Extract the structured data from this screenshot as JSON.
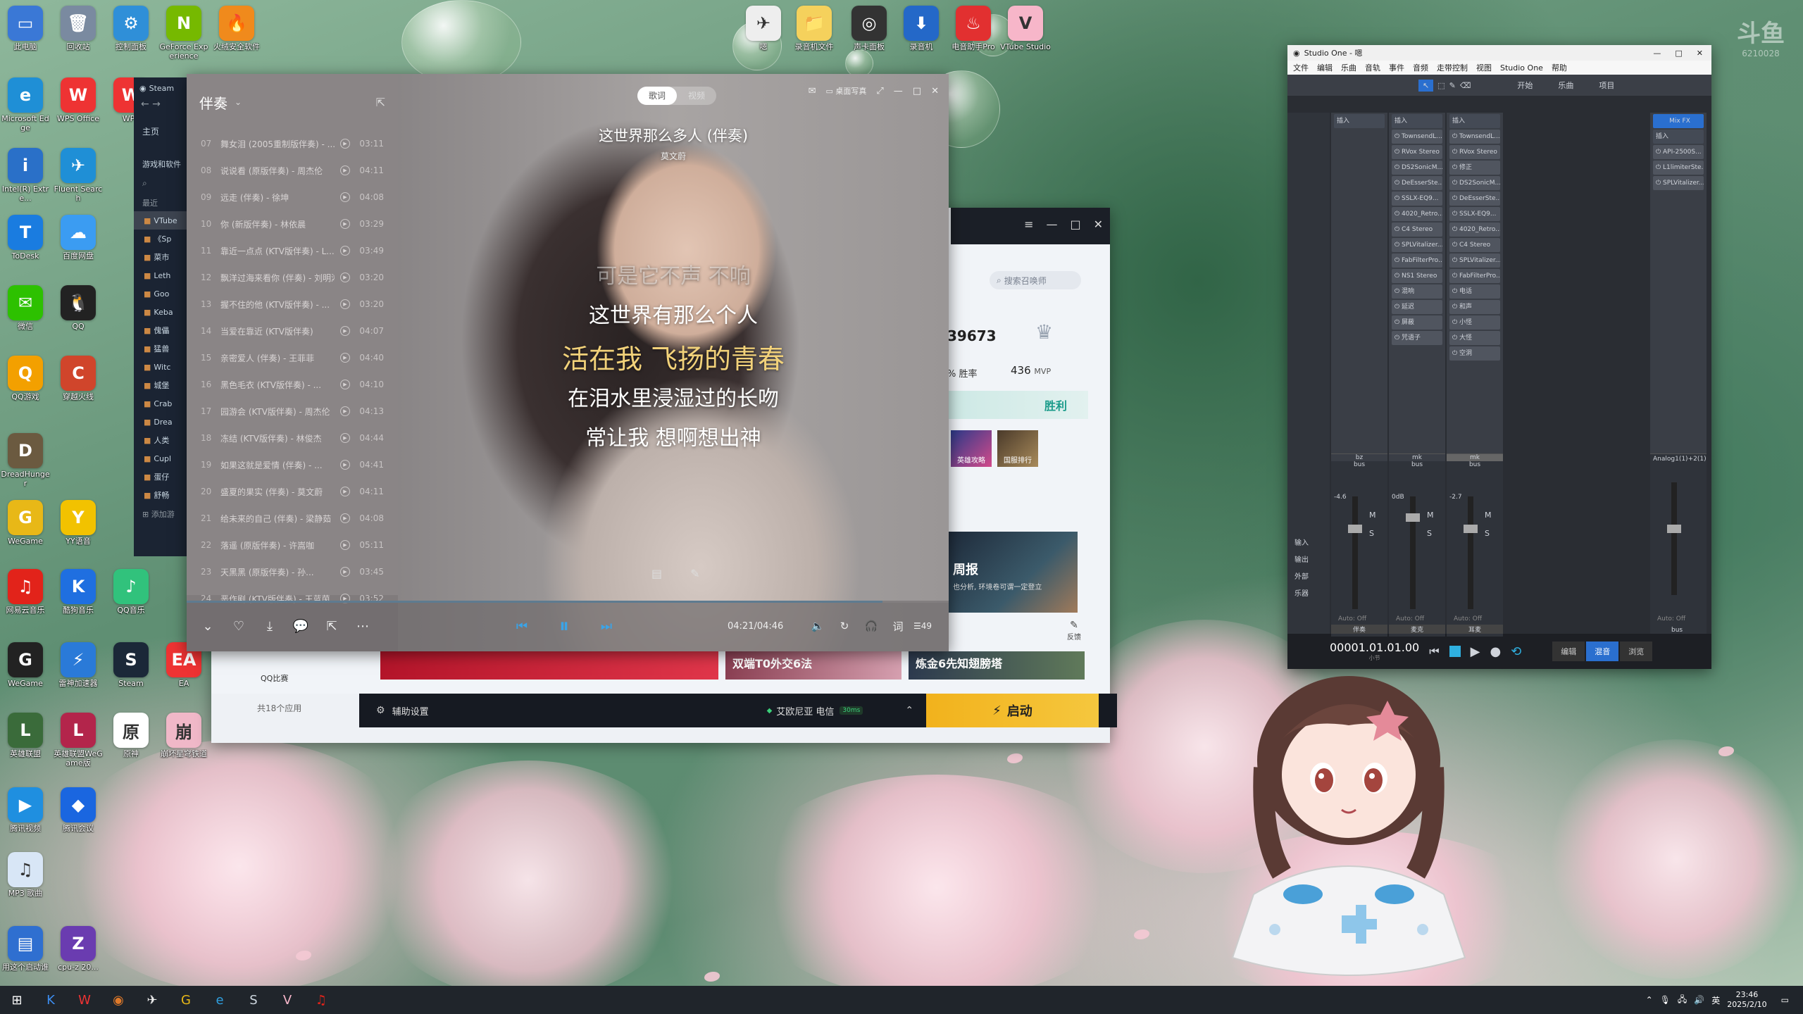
{
  "desktop": {
    "icons_left": [
      {
        "label": "此电脑",
        "color": "#3a78d6",
        "glyph": "▭"
      },
      {
        "label": "回收站",
        "color": "#7a8aa0",
        "glyph": "🗑"
      },
      {
        "label": "控制面板",
        "color": "#2f8fd8",
        "glyph": "⚙"
      },
      {
        "label": "GeForce Experience",
        "color": "#76b900",
        "glyph": "N"
      },
      {
        "label": "火绒安全软件",
        "color": "#f08a1c",
        "glyph": "🔥"
      },
      {
        "label": "Microsoft Edge",
        "color": "#1f8fd6",
        "glyph": "e"
      },
      {
        "label": "WPS Office",
        "color": "#e33",
        "glyph": "W"
      },
      {
        "label": "WPS",
        "color": "#e33",
        "glyph": "W"
      },
      {
        "label": "Intel(R) Extre...",
        "color": "#2a70c8",
        "glyph": "i"
      },
      {
        "label": "Fluent Search",
        "color": "#1f8fd6",
        "glyph": "✈"
      },
      {
        "label": "ToDesk",
        "color": "#1a7ce0",
        "glyph": "T"
      },
      {
        "label": "百度网盘",
        "color": "#3b9cf2",
        "glyph": "☁"
      },
      {
        "label": "微信",
        "color": "#2dc100",
        "glyph": "✉"
      },
      {
        "label": "QQ",
        "color": "#222",
        "glyph": "🐧"
      },
      {
        "label": "QQ游戏",
        "color": "#f3a000",
        "glyph": "Q"
      },
      {
        "label": "穿越火线",
        "color": "#d0452b",
        "glyph": "C"
      },
      {
        "label": "DreadHunger",
        "color": "#6b5a40",
        "glyph": "D"
      },
      {
        "label": "WeGame",
        "color": "#e8b817",
        "glyph": "G"
      },
      {
        "label": "YY语音",
        "color": "#f2c200",
        "glyph": "Y"
      },
      {
        "label": "网易云音乐",
        "color": "#e2231a",
        "glyph": "♫"
      },
      {
        "label": "酷狗音乐",
        "color": "#1f6fe0",
        "glyph": "K"
      },
      {
        "label": "QQ音乐",
        "color": "#31c27c",
        "glyph": "♪"
      },
      {
        "label": "WeGame",
        "color": "#222",
        "glyph": "G"
      },
      {
        "label": "雷神加速器",
        "color": "#2a7ad8",
        "glyph": "⚡"
      },
      {
        "label": "Steam",
        "color": "#1b2838",
        "glyph": "S"
      },
      {
        "label": "EA",
        "color": "#e33",
        "glyph": "EA"
      },
      {
        "label": "英雄联盟",
        "color": "#3a6b3a",
        "glyph": "L"
      },
      {
        "label": "英雄联盟WeGame版",
        "color": "#b3254b",
        "glyph": "L"
      },
      {
        "label": "原神",
        "color": "#fff",
        "glyph": "原"
      },
      {
        "label": "崩坏星穹铁道",
        "color": "#f0b8c8",
        "glyph": "崩"
      },
      {
        "label": "腾讯视频",
        "color": "#1f8fe0",
        "glyph": "▶"
      },
      {
        "label": "腾讯会议",
        "color": "#1a66e0",
        "glyph": "◆"
      },
      {
        "label": "MP3 歌曲",
        "color": "#d8e6f6",
        "glyph": "♫"
      },
      {
        "label": "用这个启动谁",
        "color": "#2f6fd0",
        "glyph": "▤"
      },
      {
        "label": "cpu-z 20...",
        "color": "#6a3cb0",
        "glyph": "Z"
      }
    ],
    "icons_top": [
      {
        "label": "嗯",
        "color": "#eee",
        "glyph": "✈"
      },
      {
        "label": "录音机文件",
        "color": "#f5d15c",
        "glyph": "📁"
      },
      {
        "label": "声卡面板",
        "color": "#333",
        "glyph": "◎"
      },
      {
        "label": "录音机",
        "color": "#2468c8",
        "glyph": "⬇"
      },
      {
        "label": "电音助手Pro",
        "color": "#e23030",
        "glyph": "♨"
      },
      {
        "label": "VTube Studio",
        "color": "#f7b6c9",
        "glyph": "V"
      }
    ],
    "watermark": "斗鱼",
    "watermark_id": "6210028"
  },
  "steam": {
    "title": "Steam",
    "home": "主页",
    "library_label": "游戏和软件",
    "recent": "最近",
    "games": [
      "VTube",
      "《Sp",
      "菜市",
      "Leth",
      "Goo",
      "Keba",
      "傀儡",
      "猛兽",
      "Witc",
      "城堡",
      "Crab",
      "Drea",
      "人类",
      "Cupl",
      "蛋仔",
      "舒畅"
    ],
    "add": "添加游"
  },
  "music": {
    "list_title": "伴奏",
    "tabs": [
      "歌词",
      "视频"
    ],
    "song_title": "这世界那么多人 (伴奏)",
    "artist": "莫文蔚",
    "lyrics": [
      {
        "text": "可是它不声 不响",
        "style": "faded"
      },
      {
        "text": "这世界有那么个人",
        "style": "normal"
      },
      {
        "text": "活在我 飞扬的青春",
        "style": "current"
      },
      {
        "text": "在泪水里浸湿过的长吻",
        "style": "normal"
      },
      {
        "text": "常让我 想啊想出神",
        "style": "normal"
      }
    ],
    "songs": [
      {
        "num": "07",
        "title": "舞女泪 (2005重制版伴奏) - ...",
        "dur": "03:11"
      },
      {
        "num": "08",
        "title": "说说看 (原版伴奏) - 周杰伦",
        "dur": "04:11"
      },
      {
        "num": "09",
        "title": "远走 (伴奏) - 徐坤",
        "dur": "04:08"
      },
      {
        "num": "10",
        "title": "你 (新版伴奏) - 林依晨",
        "dur": "03:29"
      },
      {
        "num": "11",
        "title": "靠近一点点 (KTV版伴奏) - L...",
        "dur": "03:49"
      },
      {
        "num": "12",
        "title": "飘洋过海来看你 (伴奏) - 刘明湘",
        "dur": "03:20"
      },
      {
        "num": "13",
        "title": "握不住的他 (KTV版伴奏) - ...",
        "dur": "03:20"
      },
      {
        "num": "14",
        "title": "当爱在靠近 (KTV版伴奏)",
        "dur": "04:07"
      },
      {
        "num": "15",
        "title": "亲密爱人 (伴奏) - 王菲菲",
        "dur": "04:40"
      },
      {
        "num": "16",
        "title": "黑色毛衣 (KTV版伴奏) - ...",
        "dur": "04:10"
      },
      {
        "num": "17",
        "title": "园游会 (KTV版伴奏) - 周杰伦",
        "dur": "04:13"
      },
      {
        "num": "18",
        "title": "冻结 (KTV版伴奏) - 林俊杰",
        "dur": "04:44"
      },
      {
        "num": "19",
        "title": "如果这就是爱情 (伴奏) - ...",
        "dur": "04:41"
      },
      {
        "num": "20",
        "title": "盛夏的果实 (伴奏) - 莫文蔚",
        "dur": "04:11"
      },
      {
        "num": "21",
        "title": "给未来的自己 (伴奏) - 梁静茹",
        "dur": "04:08"
      },
      {
        "num": "22",
        "title": "落遥 (原版伴奏) - 许嵩咖",
        "dur": "05:11"
      },
      {
        "num": "23",
        "title": "天黑黑 (原版伴奏) - 孙...",
        "dur": "03:45"
      },
      {
        "num": "24",
        "title": "恶作剧 (KTV版伴奏) - 王蓝茵",
        "dur": "03:52"
      }
    ],
    "time": "04:21/04:46",
    "progress": 0.913,
    "desktop_lyric_label": "桌面写真",
    "playlist_count": "49"
  },
  "launcher": {
    "search_placeholder": "搜索召唤师",
    "id_fragment": "39673",
    "winrate_suffix": "% 胜率",
    "mvp_count": "436",
    "mvp_label": "MVP",
    "result": "胜利",
    "thumbs": [
      "英雄攻略",
      "国服排行"
    ],
    "news_title": "周报",
    "news_sub": "也分析, 环境卷可谓一定登立",
    "banners": [
      "双端T0外交6法",
      "炼金6先知翅膀塔"
    ],
    "feedback": "反馈",
    "app_count": "共18个应用",
    "qq_label": "QQ比赛",
    "aux_settings": "辅助设置",
    "server": "艾欧尼亚 电信",
    "ping": "30ms",
    "launch": "启动"
  },
  "studio": {
    "title": "Studio One - 嗯",
    "menu": [
      "文件",
      "编辑",
      "乐曲",
      "音轨",
      "事件",
      "音频",
      "走带控制",
      "视图",
      "Studio One",
      "帮助"
    ],
    "toolbar": [
      "开始",
      "乐曲",
      "项目"
    ],
    "mix_fx": "Mix FX",
    "insert": "插入",
    "inserts_a": [
      "TownsendL...",
      "RVox Stereo",
      "DS2SonicM...",
      "DeEsserSte...",
      "SSLX-EQ9...",
      "4020_Retro...",
      "C4 Stereo",
      "SPLVitalizer...",
      "FabFilterPro...",
      "NS1 Stereo",
      "混响",
      "延迟",
      "屏蔽",
      "咒语子"
    ],
    "inserts_b": [
      "TownsendL...",
      "RVox Stereo",
      "修正",
      "DS2SonicM...",
      "DeEsserSte...",
      "SSLX-EQ9...",
      "4020_Retro...",
      "C4 Stereo",
      "SPLVitalizer...",
      "FabFilterPro...",
      "电话",
      "和声",
      "小怪",
      "大怪",
      "空洞"
    ],
    "inserts_mix": [
      "API-2500S...",
      "L1limiterSte...",
      "SPLVitalizer..."
    ],
    "channels": [
      {
        "name": "bz",
        "bus": "bus",
        "vol": "-4.6",
        "label": "伴奏"
      },
      {
        "name": "mk",
        "bus": "bus",
        "vol": "0dB",
        "label": "麦克"
      },
      {
        "name": "mk",
        "bus": "bus",
        "vol": "-2.7",
        "label": "耳麦"
      }
    ],
    "analog": "Analog1(1)+2(1)",
    "main_bus": "bus",
    "side_labels": [
      "输入",
      "输出",
      "外部",
      "乐器"
    ],
    "auto_off": "Auto: Off",
    "time": "00001.01.01.00",
    "time_sub": "小节",
    "bottom_tabs": [
      "编辑",
      "混音",
      "浏览"
    ]
  },
  "taskbar": {
    "time": "23:46",
    "date": "2025/2/10",
    "ime": "英"
  }
}
